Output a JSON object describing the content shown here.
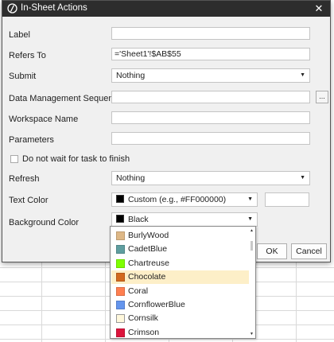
{
  "dialog": {
    "title": "In-Sheet Actions",
    "close_glyph": "✕",
    "label": {
      "label": "Label",
      "value": ""
    },
    "refers_to": {
      "label": "Refers To",
      "value": "='Sheet1'!$AB$55"
    },
    "submit": {
      "label": "Submit",
      "value": "Nothing"
    },
    "dms": {
      "label": "Data Management Sequence",
      "value": "",
      "browse": "..."
    },
    "workspace": {
      "label": "Workspace Name",
      "value": ""
    },
    "parameters": {
      "label": "Parameters",
      "value": ""
    },
    "do_not_wait": {
      "label": "Do not wait for task to finish",
      "checked": false
    },
    "refresh": {
      "label": "Refresh",
      "value": "Nothing"
    },
    "text_color": {
      "label": "Text Color",
      "value": "Custom (e.g., #FF000000)",
      "swatch": "#000000",
      "custom_value": ""
    },
    "bg_color": {
      "label": "Background Color",
      "value": "Black",
      "swatch": "#000000"
    },
    "ok": "OK",
    "cancel": "Cancel"
  },
  "dropdown": {
    "items": [
      {
        "name": "BurlyWood",
        "color": "#DEB887"
      },
      {
        "name": "CadetBlue",
        "color": "#5F9EA0"
      },
      {
        "name": "Chartreuse",
        "color": "#7FFF00"
      },
      {
        "name": "Chocolate",
        "color": "#D2691E",
        "selected": true
      },
      {
        "name": "Coral",
        "color": "#FF7F50"
      },
      {
        "name": "CornflowerBlue",
        "color": "#6495ED"
      },
      {
        "name": "Cornsilk",
        "color": "#FFF8DC"
      },
      {
        "name": "Crimson",
        "color": "#DC143C"
      }
    ]
  }
}
